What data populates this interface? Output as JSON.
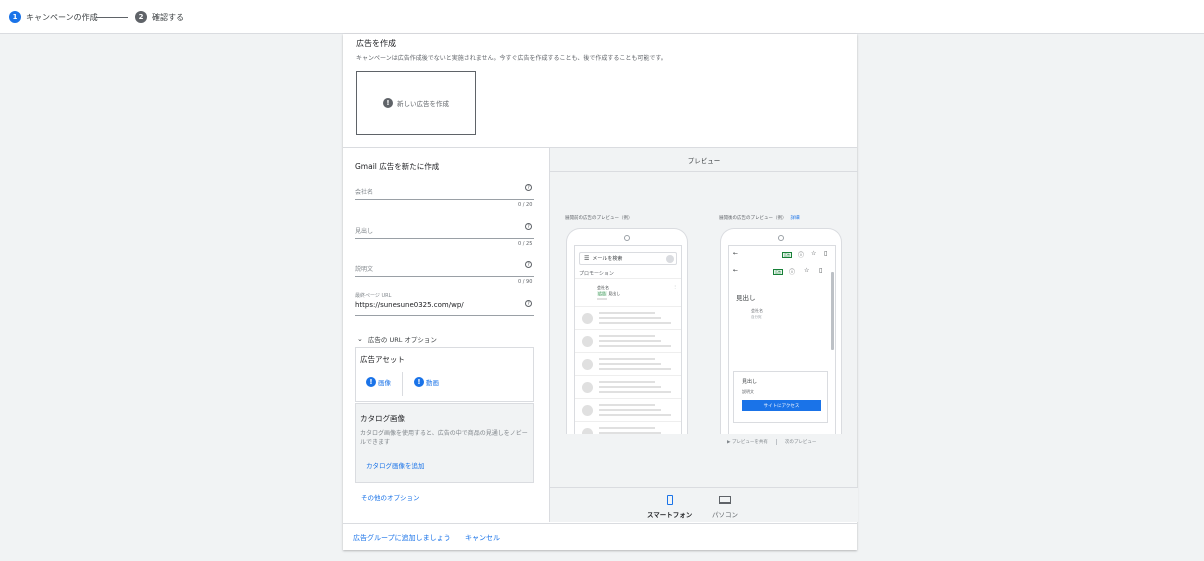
{
  "stepper": {
    "step1": {
      "num": "1",
      "label": "キャンペーンの作成"
    },
    "step2": {
      "num": "2",
      "label": "確認する"
    }
  },
  "ad_section": {
    "title": "広告を作成",
    "description": "キャンペーンは広告作成後でないと実施されません。今すぐ広告を作成することも、後で作成することも可能です。",
    "new_ad_label": "新しい広告を作成"
  },
  "gmail_form": {
    "title": "Gmail 広告を新たに作成",
    "fields": [
      {
        "label": "会社名",
        "value": "",
        "counter": "0 / 20"
      },
      {
        "label": "見出し",
        "value": "",
        "counter": "0 / 25"
      },
      {
        "label": "説明文",
        "value": "",
        "counter": "0 / 90"
      },
      {
        "label": "最終ページ URL",
        "value": "https://sunesune0325.com/wp/"
      }
    ],
    "url_options": "広告の URL オプション",
    "assets": {
      "title": "広告アセット",
      "image": "画像",
      "video": "動画"
    },
    "catalog": {
      "title": "カタログ画像",
      "description": "カタログ画像を使用すると、広告の中で商品の見通しをノビールできます",
      "add_link": "カタログ画像を追加"
    },
    "other_options": "その他のオプション"
  },
  "preview": {
    "header": "プレビュー",
    "collapsed_caption": "展開前の広告のプレビュー（例）",
    "expanded_caption": "展開後の広告のプレビュー（例）",
    "details_link": "詳細",
    "collapsed_phone": {
      "search_placeholder": "メールを検索",
      "promotions": "プロモーション",
      "ad_sender": "会社名",
      "ad_badge": "広告",
      "ad_headline": "見出し",
      "more": "⋮"
    },
    "expanded_phone": {
      "badge": "広告",
      "headline": "見出し",
      "company": "会社名",
      "sub": "自分宛",
      "card_headline": "見出し",
      "card_desc": "説明文",
      "cta": "サイトにアクセス"
    },
    "share_link": "プレビューを共有",
    "next_link": "次のプレビュー",
    "devices": {
      "smartphone": "スマートフォン",
      "pc": "パソコン"
    }
  },
  "footer": {
    "add_group": "広告グループに追加しましょう",
    "cancel": "キャンセル"
  },
  "colors": {
    "accent": "#1a73e8",
    "step_active": "#1a73e8",
    "step_inactive": "#5f6368"
  }
}
